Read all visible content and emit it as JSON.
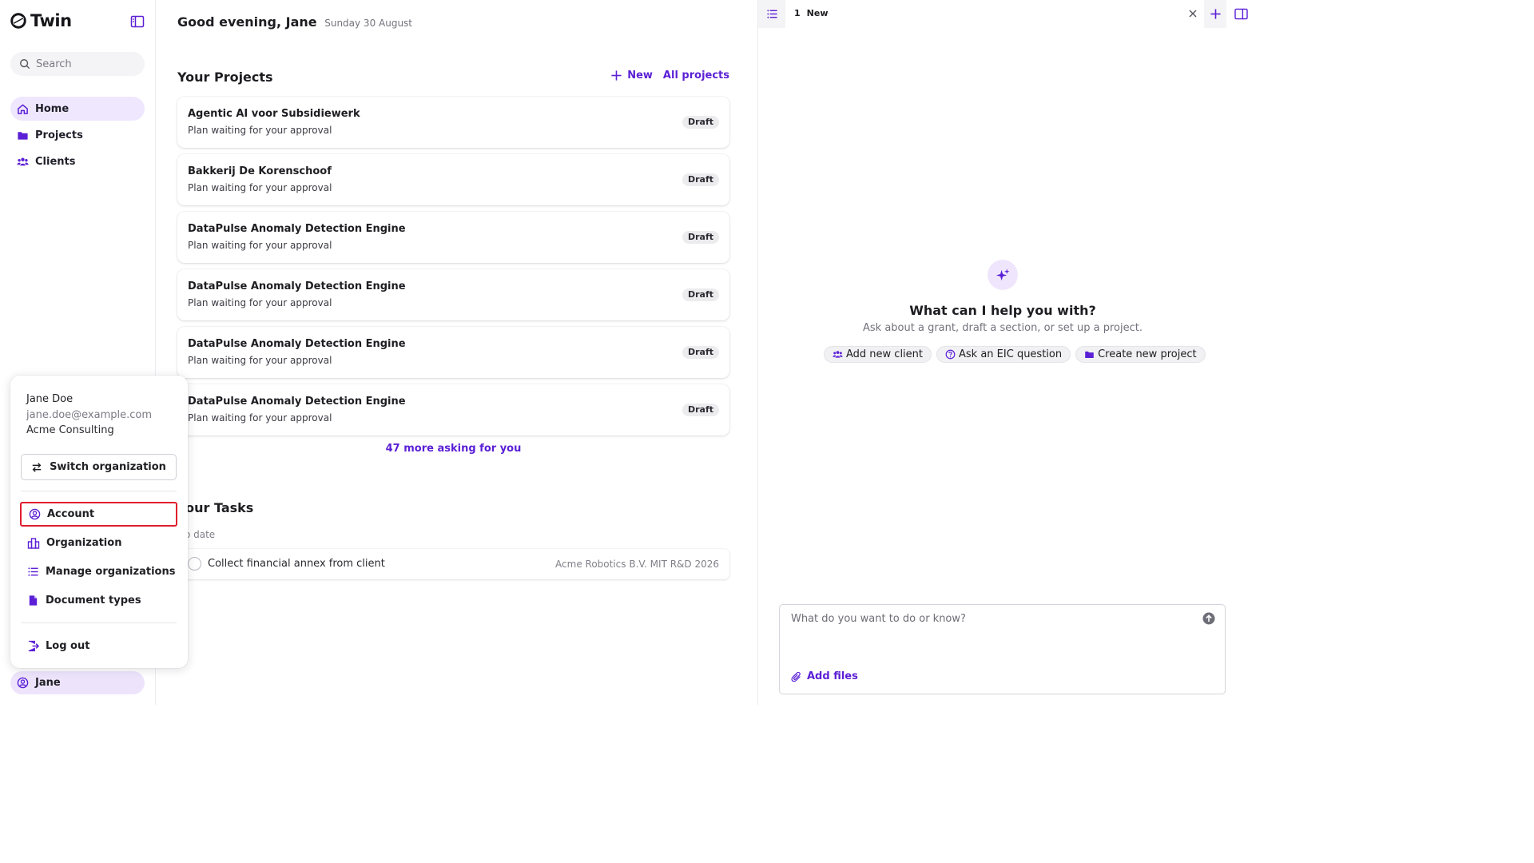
{
  "app": {
    "name": "Twin"
  },
  "sidebar": {
    "search_placeholder": "Search",
    "nav": [
      {
        "label": "Home",
        "icon": "home-icon",
        "active": true
      },
      {
        "label": "Projects",
        "icon": "folder-icon",
        "active": false
      },
      {
        "label": "Clients",
        "icon": "users-icon",
        "active": false
      }
    ],
    "user_label": "Jane"
  },
  "account_menu": {
    "name": "Jane Doe",
    "email": "jane.doe@example.com",
    "organization": "Acme Consulting",
    "switch_label": "Switch organization",
    "items": [
      {
        "label": "Account",
        "icon": "user-circle-icon",
        "highlighted": true
      },
      {
        "label": "Organization",
        "icon": "building-icon"
      },
      {
        "label": "Manage organizations",
        "icon": "list-icon"
      },
      {
        "label": "Document types",
        "icon": "document-icon"
      }
    ],
    "logout_label": "Log out"
  },
  "main": {
    "greeting": "Good evening, Jane",
    "date": "Sunday 30 August",
    "projects_title": "Your Projects",
    "new_label": "New",
    "all_projects_label": "All projects",
    "projects": [
      {
        "title": "Agentic AI voor Subsidiewerk",
        "subtitle": "Plan waiting for your approval",
        "status": "Draft"
      },
      {
        "title": "Bakkerij De Korenschoof",
        "subtitle": "Plan waiting for your approval",
        "status": "Draft"
      },
      {
        "title": "DataPulse Anomaly Detection Engine",
        "subtitle": "Plan waiting for your approval",
        "status": "Draft"
      },
      {
        "title": "DataPulse Anomaly Detection Engine",
        "subtitle": "Plan waiting for your approval",
        "status": "Draft"
      },
      {
        "title": "DataPulse Anomaly Detection Engine",
        "subtitle": "Plan waiting for your approval",
        "status": "Draft"
      },
      {
        "title": "DataPulse Anomaly Detection Engine",
        "subtitle": "Plan waiting for your approval",
        "status": "Draft"
      }
    ],
    "more_label": "47 more asking for you",
    "tasks_title": "Your Tasks",
    "tasks_subtitle": "No date",
    "tasks": [
      {
        "label": "Collect financial annex from client",
        "meta": "Acme Robotics B.V. MIT R&D 2026"
      }
    ]
  },
  "panel": {
    "tab_number": "1",
    "tab_label": "New",
    "help_title": "What can I help you with?",
    "help_subtitle": "Ask about a grant, draft a section, or set up a project.",
    "chips": [
      {
        "label": "Add new client",
        "icon": "users-icon"
      },
      {
        "label": "Ask an EIC question",
        "icon": "question-circle-icon"
      },
      {
        "label": "Create new project",
        "icon": "folder-icon"
      }
    ],
    "composer_placeholder": "What do you want to do or know?",
    "add_files_label": "Add files"
  },
  "colors": {
    "accent": "#5b1fd6",
    "active_nav_bg": "#efe7fd",
    "highlight_border": "#e01e2e"
  }
}
